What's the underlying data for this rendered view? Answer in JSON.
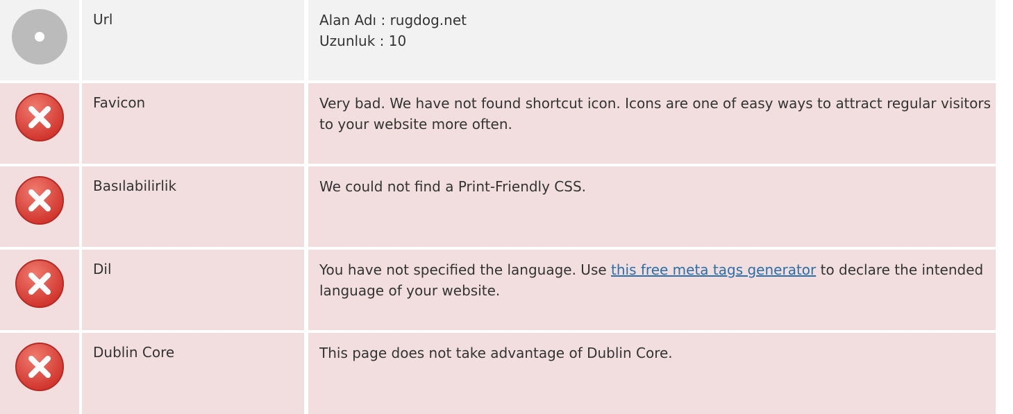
{
  "rows": [
    {
      "status": "neutral",
      "icon": "grey-dot-icon",
      "label": "Url",
      "lines": [
        "Alan Adı : rugdog.net",
        "Uzunluk : 10"
      ]
    },
    {
      "status": "bad",
      "icon": "error-x-icon",
      "label": "Favicon",
      "text": "Very bad. We have not found shortcut icon. Icons are one of easy ways to attract regular visitors to your website more often."
    },
    {
      "status": "bad",
      "icon": "error-x-icon",
      "label": "Basılabilirlik",
      "text": "We could not find a Print-Friendly CSS."
    },
    {
      "status": "bad",
      "icon": "error-x-icon",
      "label": "Dil",
      "text_before": "You have not specified the language. Use ",
      "link_text": "this free meta tags generator",
      "text_after": " to declare the intended language of your website."
    },
    {
      "status": "bad",
      "icon": "error-x-icon",
      "label": "Dublin Core",
      "text": "This page does not take advantage of Dublin Core."
    }
  ],
  "colors": {
    "neutral_bg": "#f2f2f2",
    "bad_bg": "#f2dede",
    "error_icon": "#d9534f",
    "link": "#2a6fa8"
  }
}
